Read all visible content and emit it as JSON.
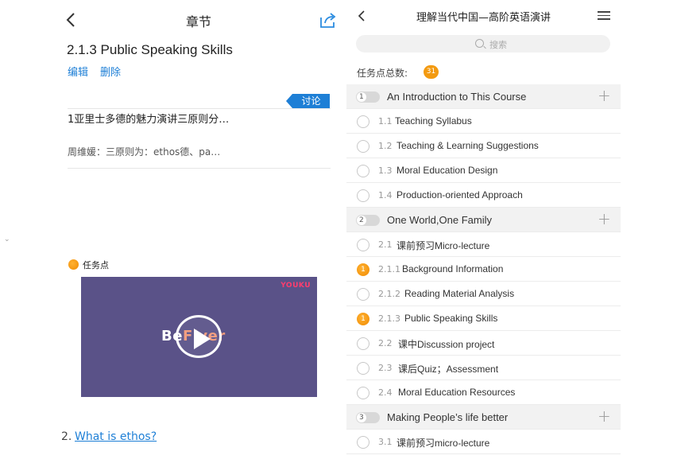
{
  "left": {
    "header_title": "章节",
    "section_title": "2.1.3 Public Speaking Skills",
    "actions": {
      "edit": "编辑",
      "delete": "删除"
    },
    "discussion": {
      "tag": "讨论",
      "title": "1亚里士多德的魅力演讲三原则分…",
      "reply": "周维媛：三原则为：ethos德、pa…"
    },
    "task_label": "任务点",
    "video": {
      "watermark": "YOUKU",
      "brand_a": "Be",
      "brand_b": "Fiver"
    },
    "question": {
      "number": "2.",
      "link_text": "What is ethos?"
    }
  },
  "right": {
    "header_title": "理解当代中国—高阶英语演讲",
    "search_placeholder": "搜索",
    "task_count_label": "任务点总数:",
    "task_count": "31",
    "rows": [
      {
        "type": "chapter",
        "num": "1",
        "label": "An Introduction to This Course"
      },
      {
        "type": "item",
        "num": "1.1",
        "label": "Teaching Syllabus",
        "task": ""
      },
      {
        "type": "item",
        "num": "1.2",
        "label": "Teaching & Learning Suggestions",
        "task": ""
      },
      {
        "type": "item",
        "num": "1.3",
        "label": "Moral Education Design",
        "task": ""
      },
      {
        "type": "item",
        "num": "1.4",
        "label": "Production-oriented Approach",
        "task": ""
      },
      {
        "type": "chapter",
        "num": "2",
        "label": "One  World,One Family"
      },
      {
        "type": "item",
        "num": "2.1",
        "label": "课前预习Micro-lecture",
        "task": ""
      },
      {
        "type": "item",
        "num": "2.1.1",
        "label": "Background Information",
        "task": "1"
      },
      {
        "type": "item",
        "num": "2.1.2",
        "label": "Reading Material Analysis",
        "task": ""
      },
      {
        "type": "item",
        "num": "2.1.3",
        "label": "Public Speaking Skills",
        "task": "1"
      },
      {
        "type": "item",
        "num": "2.2",
        "label": "课中Discussion project",
        "task": ""
      },
      {
        "type": "item",
        "num": "2.3",
        "label": "课后Quiz；Assessment",
        "task": ""
      },
      {
        "type": "item",
        "num": "2.4",
        "label": "Moral Education Resources",
        "task": ""
      },
      {
        "type": "chapter",
        "num": "3",
        "label": "Making People’s life better"
      },
      {
        "type": "item",
        "num": "3.1",
        "label": "课前预习micro-lecture",
        "task": ""
      }
    ]
  }
}
